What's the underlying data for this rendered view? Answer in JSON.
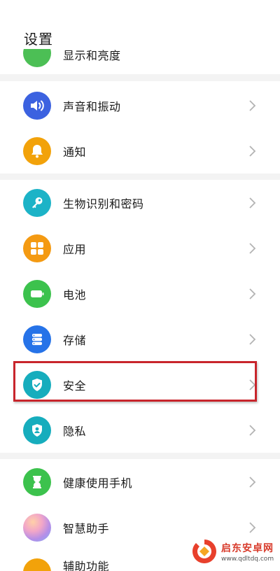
{
  "header": {
    "title": "设置"
  },
  "rows": {
    "partial_top": {
      "label": "显示和亮度",
      "color": "#4cbf55"
    },
    "sound": {
      "label": "声音和振动",
      "color": "#3c62e0"
    },
    "notify": {
      "label": "通知",
      "color": "#f2a20a"
    },
    "bio": {
      "label": "生物识别和密码",
      "color": "#1cb3c7"
    },
    "apps": {
      "label": "应用",
      "color": "#f49a12"
    },
    "battery": {
      "label": "电池",
      "color": "#3cc24d"
    },
    "storage": {
      "label": "存储",
      "color": "#2673e8"
    },
    "security": {
      "label": "安全",
      "color": "#16adbd"
    },
    "privacy": {
      "label": "隐私",
      "color": "#16adbd"
    },
    "health": {
      "label": "健康使用手机",
      "color": "#3cc24d"
    },
    "assistant": {
      "label": "智慧助手",
      "color": "#b48ee8"
    },
    "accessibility": {
      "label": "辅助功能",
      "color": "#f2a20a"
    }
  },
  "highlight": {
    "target": "安全",
    "color": "#c8252c"
  },
  "watermark": {
    "title": "启东安卓网",
    "url": "www.qdltdq.com"
  }
}
